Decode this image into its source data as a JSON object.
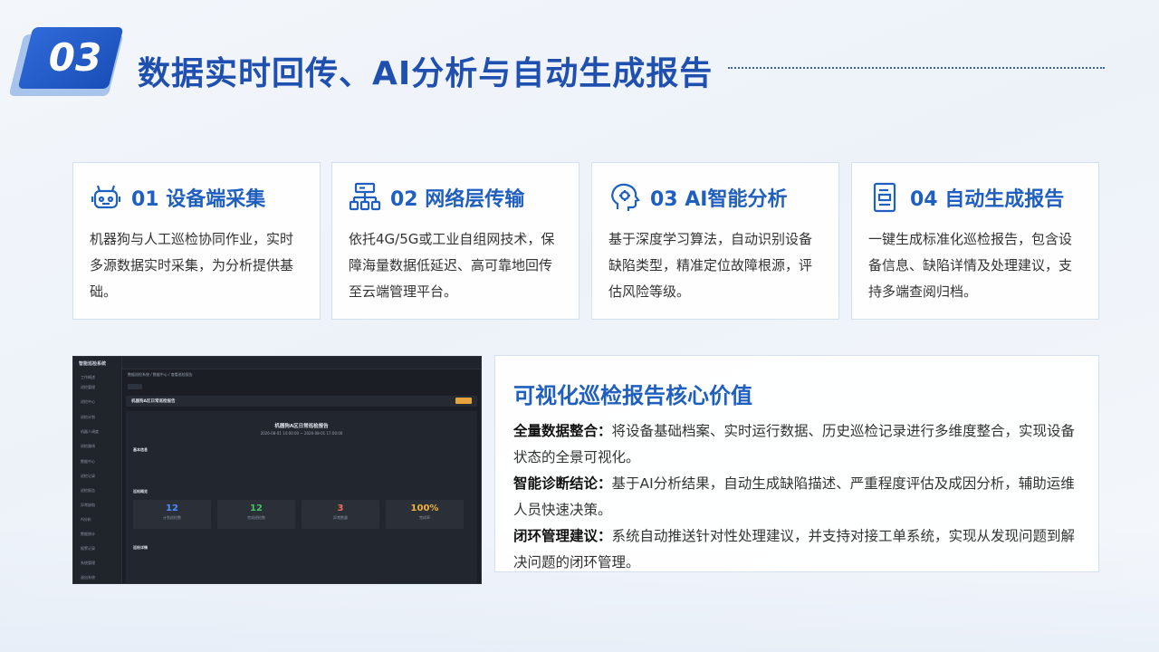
{
  "header": {
    "number": "03",
    "title": "数据实时回传、AI分析与自动生成报告"
  },
  "cards": [
    {
      "icon": "robot-icon",
      "title": "01 设备端采集",
      "body": "机器狗与人工巡检协同作业，实时多源数据实时采集，为分析提供基础。"
    },
    {
      "icon": "network-icon",
      "title": "02 网络层传输",
      "body": "依托4G/5G或工业自组网技术，保障海量数据低延迟、高可靠地回传至云端管理平台。"
    },
    {
      "icon": "brain-icon",
      "title": "03 AI智能分析",
      "body": "基于深度学习算法，自动识别设备缺陷类型，精准定位故障根源，评估风险等级。"
    },
    {
      "icon": "report-icon",
      "title": "04 自动生成报告",
      "body": "一键生成标准化巡检报告，包含设备信息、缺陷详情及处理建议，支持多端查阅归档。"
    }
  ],
  "screenshot": {
    "app_name": "智能巡检系统",
    "sidebar": [
      "工作概述",
      "巡检管理",
      "巡检中心",
      "巡检计划",
      "机器人调度",
      "巡检路线",
      "数据中心",
      "巡检记录",
      "巡检报告",
      "异常缺陷",
      "AI分析",
      "数据统计",
      "报警记录",
      "系统管理",
      "退出系统"
    ],
    "breadcrumb": "数据巡检系统 / 数据中心 / 查看巡检报告",
    "report_bar_title": "机器狗A区日常巡检报告",
    "doc_title": "机器狗A区日常巡检报告",
    "doc_period": "2026-08-01 14:00:00 ~ 2026-08-01 17:00:00",
    "sec_basic": "基本信息",
    "sec_summary": "巡检概览",
    "sec_detail": "巡检详情",
    "stats": [
      {
        "value": "12",
        "label": "计划巡检数",
        "color": "#4c8dff"
      },
      {
        "value": "12",
        "label": "完成巡检数",
        "color": "#43c463"
      },
      {
        "value": "3",
        "label": "异常数量",
        "color": "#f06b5e"
      },
      {
        "value": "100%",
        "label": "完成率",
        "color": "#f2b13b"
      }
    ]
  },
  "panel": {
    "title": "可视化巡检报告核心价值",
    "items": [
      {
        "key": "全量数据整合：",
        "text": "将设备基础档案、实时运行数据、历史巡检记录进行多维度整合，实现设备状态的全景可视化。"
      },
      {
        "key": "智能诊断结论：",
        "text": "基于AI分析结果，自动生成缺陷描述、严重程度评估及成因分析，辅助运维人员快速决策。"
      },
      {
        "key": "闭环管理建议：",
        "text": "系统自动推送针对性处理建议，并支持对接工单系统，实现从发现问题到解决问题的闭环管理。"
      }
    ]
  }
}
